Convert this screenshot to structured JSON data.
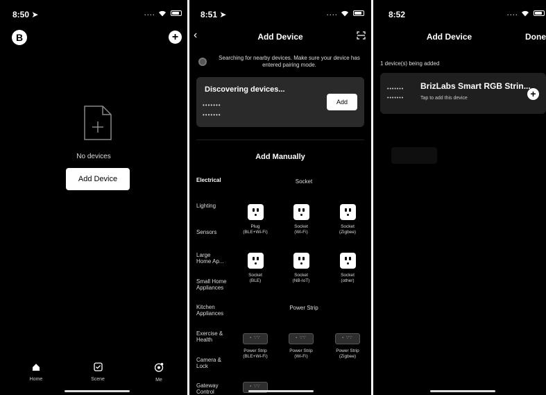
{
  "screen1": {
    "time": "8:50",
    "signal": "....",
    "logo": "B",
    "add_icon": "+",
    "empty_text": "No devices",
    "add_device_label": "Add Device",
    "tabs": [
      {
        "label": "Home",
        "icon": "home-icon"
      },
      {
        "label": "Scene",
        "icon": "scene-icon"
      },
      {
        "label": "Me",
        "icon": "me-icon"
      }
    ]
  },
  "screen2": {
    "time": "8:51",
    "signal": "....",
    "title": "Add Device",
    "searching_text": "Searching for nearby devices. Make sure your device has entered pairing mode.",
    "discovering_title": "Discovering devices...",
    "dots_1": "•••••••",
    "dots_2": "•••••••",
    "add_label": "Add",
    "manual_title": "Add Manually",
    "categories": [
      "Electrical",
      "Lighting",
      "Sensors",
      "Large Home Ap...",
      "Small Home Appliances",
      "Kitchen Appliances",
      "Exercise & Health",
      "Camera & Lock",
      "Gateway Control"
    ],
    "socket_header": "Socket",
    "power_strip_header": "Power Strip",
    "sockets": [
      {
        "line1": "Plug",
        "line2": "(BLE+Wi-Fi)"
      },
      {
        "line1": "Socket",
        "line2": "(Wi-Fi)"
      },
      {
        "line1": "Socket",
        "line2": "(Zigbee)"
      },
      {
        "line1": "Socket",
        "line2": "(BLE)"
      },
      {
        "line1": "Socket",
        "line2": "(NB-IoT)"
      },
      {
        "line1": "Socket",
        "line2": "(other)"
      }
    ],
    "strips": [
      {
        "line1": "Power Strip",
        "line2": "(BLE+Wi-Fi)"
      },
      {
        "line1": "Power Strip",
        "line2": "(Wi-Fi)"
      },
      {
        "line1": "Power Strip",
        "line2": "(Zigbee)"
      }
    ]
  },
  "screen3": {
    "time": "8:52",
    "signal": "....",
    "title": "Add Device",
    "done_label": "Done",
    "being_added": "1 device(s) being added",
    "device_name": "BrizLabs Smart RGB Strin...",
    "device_sub": "Tap to add this device",
    "dots_1": "•••••••",
    "dots_2": "•••••••"
  }
}
